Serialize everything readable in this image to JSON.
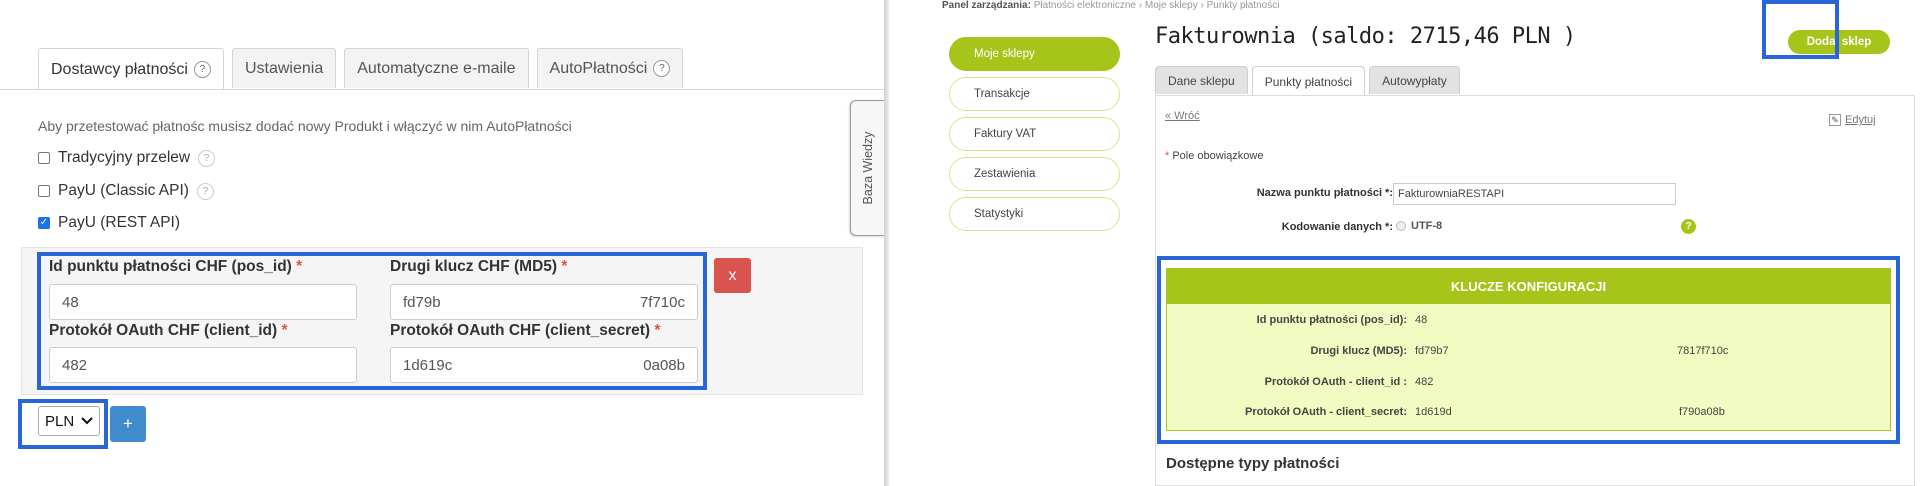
{
  "left": {
    "tabs": [
      {
        "label": "Dostawcy płatności",
        "help": "?"
      },
      {
        "label": "Ustawienia"
      },
      {
        "label": "Automatyczne e-maile"
      },
      {
        "label": "AutoPłatności",
        "help": "?"
      }
    ],
    "hint": "Aby przetestować płatnośc musisz dodać nowy Produkt i włączyć w nim AutoPłatności",
    "methods": [
      {
        "label": "Tradycyjny przelew",
        "checked": false,
        "help": "?"
      },
      {
        "label": "PayU (Classic API)",
        "checked": false,
        "help": "?"
      },
      {
        "label": "PayU (REST API)",
        "checked": true
      }
    ],
    "fields": {
      "pos_id": {
        "label": "Id punktu płatności CHF (pos_id)",
        "required": "*",
        "value": "48"
      },
      "md5": {
        "label": "Drugi klucz CHF (MD5)",
        "required": "*",
        "value_start": "fd79b",
        "value_end": "7f710c"
      },
      "client_id": {
        "label": "Protokół OAuth CHF (client_id)",
        "required": "*",
        "value": "482"
      },
      "client_secret": {
        "label": "Protokół OAuth CHF (client_secret)",
        "required": "*",
        "value_start": "1d619c",
        "value_end": "0a08b"
      }
    },
    "remove_label": "x",
    "currency": "PLN",
    "add_label": "+",
    "knowledge_base": "Baza Wiedzy"
  },
  "right": {
    "breadcrumb": {
      "root": "Panel zarządzania:",
      "items": [
        "Płatności elektroniczne",
        "Moje sklepy",
        "Punkty płatności"
      ],
      "separator": "›"
    },
    "menu": [
      "Moje sklepy",
      "Transakcje",
      "Faktury VAT",
      "Zestawienia",
      "Statystyki"
    ],
    "title": "Fakturownia (saldo: 2715,46 PLN )",
    "add_shop": "Dodaj sklep",
    "tabs": [
      "Dane sklepu",
      "Punkty płatności",
      "Autowypłaty"
    ],
    "back": "« Wróć",
    "edit": "Edytuj",
    "required_note": "Pole obowiązkowe",
    "form": {
      "name_label": "Nazwa punktu płatności *:",
      "name_value": "FakturowniaRESTAPI",
      "encoding_label": "Kodowanie danych *:",
      "encoding_value": "UTF-8",
      "help": "?"
    },
    "keys": {
      "header": "KLUCZE KONFIGURACJI",
      "rows": [
        {
          "label": "Id punktu płatności (pos_id):",
          "value_start": "48",
          "value_end": ""
        },
        {
          "label": "Drugi klucz (MD5):",
          "value_start": "fd79b7",
          "value_end": "7817f710c"
        },
        {
          "label": "Protokół OAuth - client_id :",
          "value_start": "482",
          "value_end": ""
        },
        {
          "label": "Protokół OAuth - client_secret:",
          "value_start": "1d619d",
          "value_end": "f790a08b"
        }
      ]
    },
    "available_types": "Dostępne typy płatności"
  },
  "colors": {
    "highlight": "#2866d8",
    "accent_green": "#a6c41a",
    "keys_bg": "#f2fcc2",
    "danger": "#d9534f",
    "primary": "#428bca"
  }
}
